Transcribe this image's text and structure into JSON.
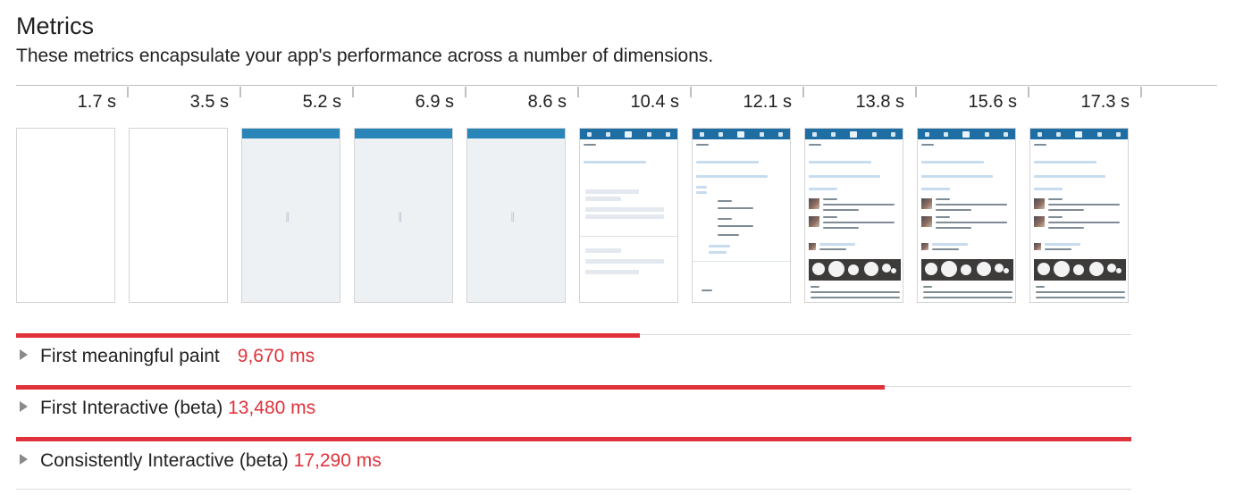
{
  "header": {
    "title": "Metrics",
    "subtitle": "These metrics encapsulate your app's performance across a number of dimensions."
  },
  "filmstrip": [
    {
      "time": "1.7 s",
      "state": "blank"
    },
    {
      "time": "3.5 s",
      "state": "blank"
    },
    {
      "time": "5.2 s",
      "state": "loading"
    },
    {
      "time": "6.9 s",
      "state": "loading"
    },
    {
      "time": "8.6 s",
      "state": "loading"
    },
    {
      "time": "10.4 s",
      "state": "skeleton"
    },
    {
      "time": "12.1 s",
      "state": "partial"
    },
    {
      "time": "13.8 s",
      "state": "complete"
    },
    {
      "time": "15.6 s",
      "state": "complete"
    },
    {
      "time": "17.3 s",
      "state": "complete"
    }
  ],
  "metrics": [
    {
      "label": "First meaningful paint",
      "value": "9,670 ms",
      "fraction": 0.559
    },
    {
      "label": "First Interactive (beta)",
      "value": "13,480 ms",
      "fraction": 0.779
    },
    {
      "label": "Consistently Interactive (beta)",
      "value": "17,290 ms",
      "fraction": 1.0
    }
  ],
  "colors": {
    "metric_bar": "#e0323a",
    "metric_value": "#e0323a",
    "app_header": "#2a85b8"
  },
  "icons": {
    "expand": "triangle-right-icon",
    "loading": "loading-spinner-icon"
  }
}
